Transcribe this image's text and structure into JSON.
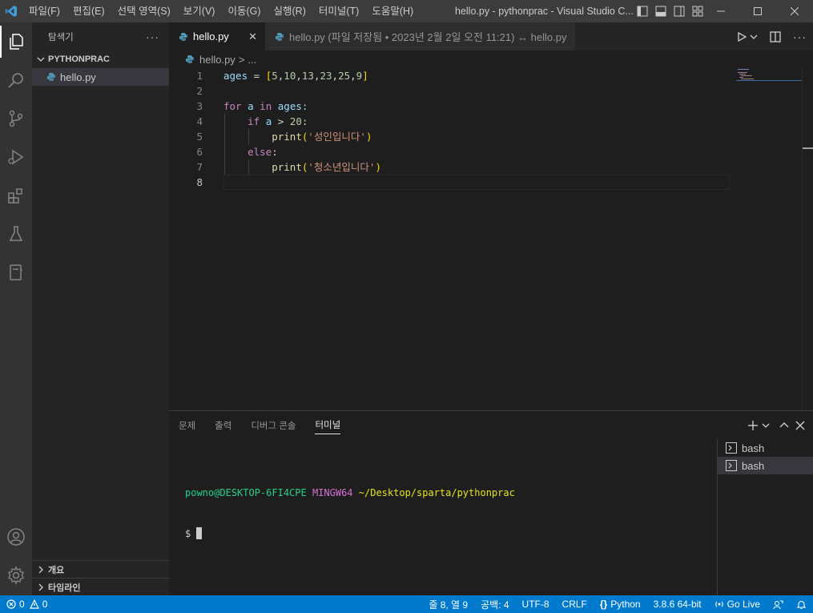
{
  "titlebar": {
    "menu": [
      "파일(F)",
      "편집(E)",
      "선택 영역(S)",
      "보기(V)",
      "이동(G)",
      "실행(R)",
      "터미널(T)",
      "도움말(H)"
    ],
    "title": "hello.py - pythonprac - Visual Studio C..."
  },
  "sidebar": {
    "header": "탐색기",
    "more": "···",
    "folder": "PYTHONPRAC",
    "file": "hello.py",
    "outline": "개요",
    "timeline": "타임라인"
  },
  "tabs": {
    "active_label": "hello.py",
    "close": "✕",
    "inactive_label": "hello.py (파일 저장됨 • 2023년 2월 2일 오전 11:21) ↔ hello.py"
  },
  "breadcrumb": {
    "file": "hello.py",
    "sep": ">",
    "rest": "..."
  },
  "editor": {
    "line_numbers": [
      "1",
      "2",
      "3",
      "4",
      "5",
      "6",
      "7",
      "8"
    ],
    "current_line": "8"
  },
  "panel": {
    "tabs": [
      "문제",
      "출력",
      "디버그 콘솔",
      "터미널"
    ],
    "active_tab": "터미널",
    "terminal_user": "powno@DESKTOP-6FI4CPE",
    "terminal_env": "MINGW64",
    "terminal_path": "~/Desktop/sparta/pythonprac",
    "terminal_prompt": "$",
    "terminals": [
      "bash",
      "bash"
    ]
  },
  "statusbar": {
    "errors": "0",
    "warnings": "0",
    "position": "줄 8, 열 9",
    "spaces": "공백: 4",
    "encoding": "UTF-8",
    "eol": "CRLF",
    "language": "Python",
    "interpreter": "3.8.6 64-bit",
    "golive": "Go Live"
  },
  "colors": {
    "accent": "#007acc",
    "keyword": "#c586c0",
    "string": "#ce9178",
    "number": "#b5cea8",
    "function": "#dcdcaa",
    "variable": "#9cdcfe",
    "terminal_user": "#23d18b",
    "terminal_env": "#d670d6",
    "terminal_path": "#e5e510"
  }
}
